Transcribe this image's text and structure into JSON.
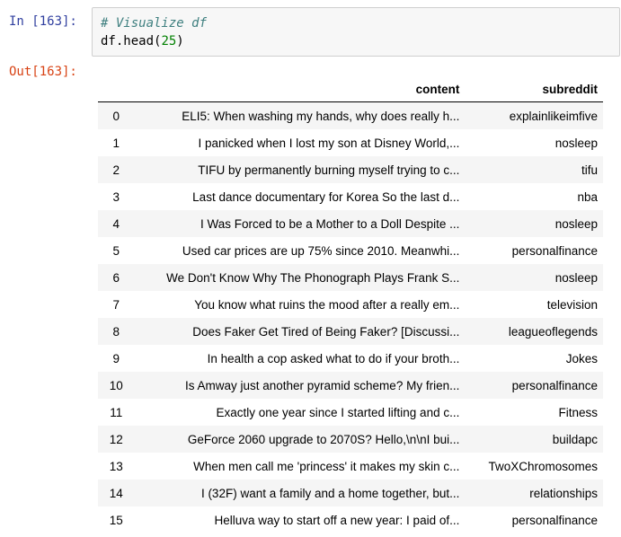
{
  "input_cell": {
    "prompt": "In [163]:",
    "comment": "# Visualize df",
    "code_prefix": "df.head(",
    "code_arg": "25",
    "code_suffix": ")"
  },
  "output_cell": {
    "prompt": "Out[163]:"
  },
  "table": {
    "columns": [
      "content",
      "subreddit"
    ],
    "rows": [
      {
        "index": "0",
        "content": "ELI5: When washing my hands, why does really h...",
        "subreddit": "explainlikeimfive"
      },
      {
        "index": "1",
        "content": "I panicked when I lost my son at Disney World,...",
        "subreddit": "nosleep"
      },
      {
        "index": "2",
        "content": "TIFU by permanently burning myself trying to c...",
        "subreddit": "tifu"
      },
      {
        "index": "3",
        "content": "Last dance documentary for Korea So the last d...",
        "subreddit": "nba"
      },
      {
        "index": "4",
        "content": "I Was Forced to be a Mother to a Doll Despite ...",
        "subreddit": "nosleep"
      },
      {
        "index": "5",
        "content": "Used car prices are up 75% since 2010. Meanwhi...",
        "subreddit": "personalfinance"
      },
      {
        "index": "6",
        "content": "We Don't Know Why The Phonograph Plays Frank S...",
        "subreddit": "nosleep"
      },
      {
        "index": "7",
        "content": "You know what ruins the mood after a really em...",
        "subreddit": "television"
      },
      {
        "index": "8",
        "content": "Does Faker Get Tired of Being Faker? [Discussi...",
        "subreddit": "leagueoflegends"
      },
      {
        "index": "9",
        "content": "In health a cop asked what to do if your broth...",
        "subreddit": "Jokes"
      },
      {
        "index": "10",
        "content": "Is Amway just another pyramid scheme? My frien...",
        "subreddit": "personalfinance"
      },
      {
        "index": "11",
        "content": "Exactly one year since I started lifting and c...",
        "subreddit": "Fitness"
      },
      {
        "index": "12",
        "content": "GeForce 2060 upgrade to 2070S? Hello,\\n\\nI bui...",
        "subreddit": "buildapc"
      },
      {
        "index": "13",
        "content": "When men call me 'princess' it makes my skin c...",
        "subreddit": "TwoXChromosomes"
      },
      {
        "index": "14",
        "content": "I (32F) want a family and a home together, but...",
        "subreddit": "relationships"
      },
      {
        "index": "15",
        "content": "Helluva way to start off a new year: I paid of...",
        "subreddit": "personalfinance"
      }
    ]
  }
}
